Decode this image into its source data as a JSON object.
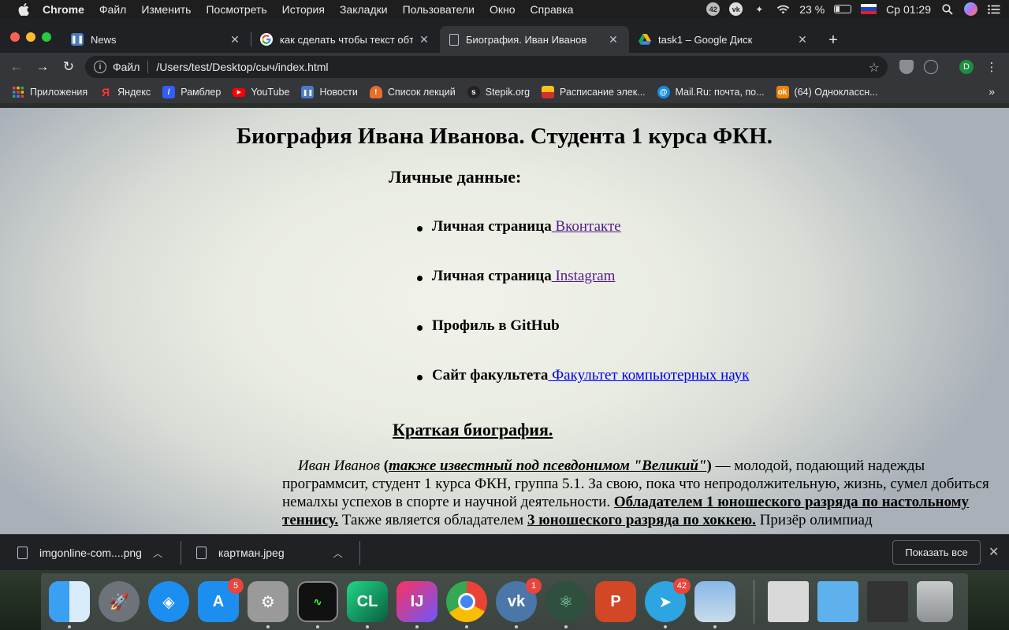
{
  "menubar": {
    "app_name": "Chrome",
    "items": [
      "Файл",
      "Изменить",
      "Посмотреть",
      "История",
      "Закладки",
      "Пользователи",
      "Окно",
      "Справка"
    ],
    "battery_percent": "23 %",
    "clock": "Ср 01:29"
  },
  "tabs": [
    {
      "title": "News",
      "favicon": "news-icon",
      "active": false
    },
    {
      "title": "как сделать чтобы текст обте",
      "favicon": "google-icon",
      "active": false
    },
    {
      "title": "Биография. Иван Иванов",
      "favicon": "document-icon",
      "active": true
    },
    {
      "title": "task1 – Google Диск",
      "favicon": "google-drive-icon",
      "active": false
    }
  ],
  "address_bar": {
    "scheme_label": "Файл",
    "url": "/Users/test/Desktop/сыч/index.html"
  },
  "profile_initial": "D",
  "bookmarks": [
    {
      "label": "Приложения",
      "icon": "apps-grid-icon"
    },
    {
      "label": "Яндекс",
      "icon": "yandex-icon"
    },
    {
      "label": "Рамблер",
      "icon": "rambler-icon"
    },
    {
      "label": "YouTube",
      "icon": "youtube-icon"
    },
    {
      "label": "Новости",
      "icon": "news-icon"
    },
    {
      "label": "Список лекций",
      "icon": "lectures-icon"
    },
    {
      "label": "Stepik.org",
      "icon": "stepik-icon"
    },
    {
      "label": "Расписание элек...",
      "icon": "schedule-icon"
    },
    {
      "label": "Mail.Ru: почта, по...",
      "icon": "mailru-icon"
    },
    {
      "label": "(64) Одноклассн...",
      "icon": "odnoklassniki-icon"
    }
  ],
  "page": {
    "heading": "Биография Ивана Иванова. Студента 1 курса ФКН.",
    "personal_heading": "Личные данные:",
    "links": [
      {
        "label": "Личная страница",
        "link_text": " Вконтакте",
        "state": "visited"
      },
      {
        "label": "Личная страница",
        "link_text": " Instagram",
        "state": "visited"
      },
      {
        "label": "Профиль в GitHub",
        "link_text": "",
        "state": "none"
      },
      {
        "label": "Сайт факультета",
        "link_text": " Факультет компьютерных наук",
        "state": "link"
      }
    ],
    "bio_heading": "Краткая биография.",
    "bio": {
      "name": "Иван Иванов",
      "open_paren": " (",
      "alias": "также известный под псевдонимом \"Великий\"",
      "close_paren": ")",
      "text1": " — молодой, подающий надежды программсит, студент 1 курса ФКН, группа 5.1. За свою, пока что непродолжительную, жизнь, сумел добиться немалхы успехов в спорте и научной деятельности. ",
      "award1": "Обладателем 1 юношеского разряда по настольному теннису.",
      "text2": " Также является обладателем ",
      "award2": "3 юношеского разряда по хоккею.",
      "text3": " Призёр олимпиад"
    }
  },
  "downloads": [
    {
      "filename": "imgonline-com....png"
    },
    {
      "filename": "картман.jpeg"
    }
  ],
  "show_all_label": "Показать все",
  "dock": {
    "appstore_badge": "5",
    "vk_badge": "1",
    "telegram_badge": "42"
  }
}
